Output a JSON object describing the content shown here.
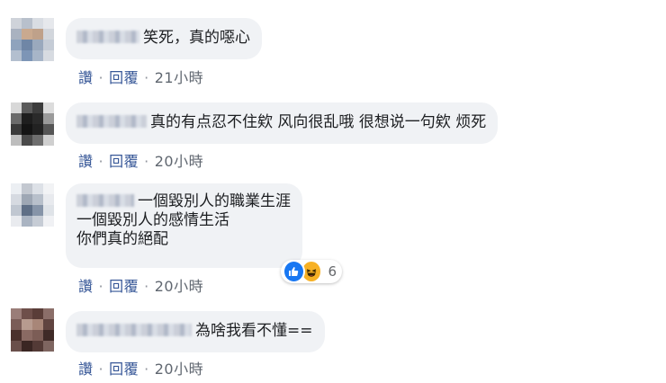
{
  "actions": {
    "like": "讚",
    "reply": "回覆",
    "separator": "·"
  },
  "comments": [
    {
      "text": "笑死，真的噁心",
      "time": "21小時"
    },
    {
      "text": "真的有点忍不住欸 风向很乱哦 很想说一句欸 烦死",
      "time": "20小時"
    },
    {
      "lines": [
        "一個毀別人的職業生涯",
        "一個毀別人的感情生活",
        "你們真的絕配"
      ],
      "time": "20小時",
      "reactions": {
        "icons": [
          "like-icon",
          "haha-icon"
        ],
        "count": "6"
      }
    },
    {
      "text": "為啥我看不懂==",
      "time": "20小時"
    }
  ],
  "colors": {
    "bubble": "#f0f2f5",
    "link": "#385898",
    "like": "#1877f2",
    "haha": "#f7b125"
  }
}
